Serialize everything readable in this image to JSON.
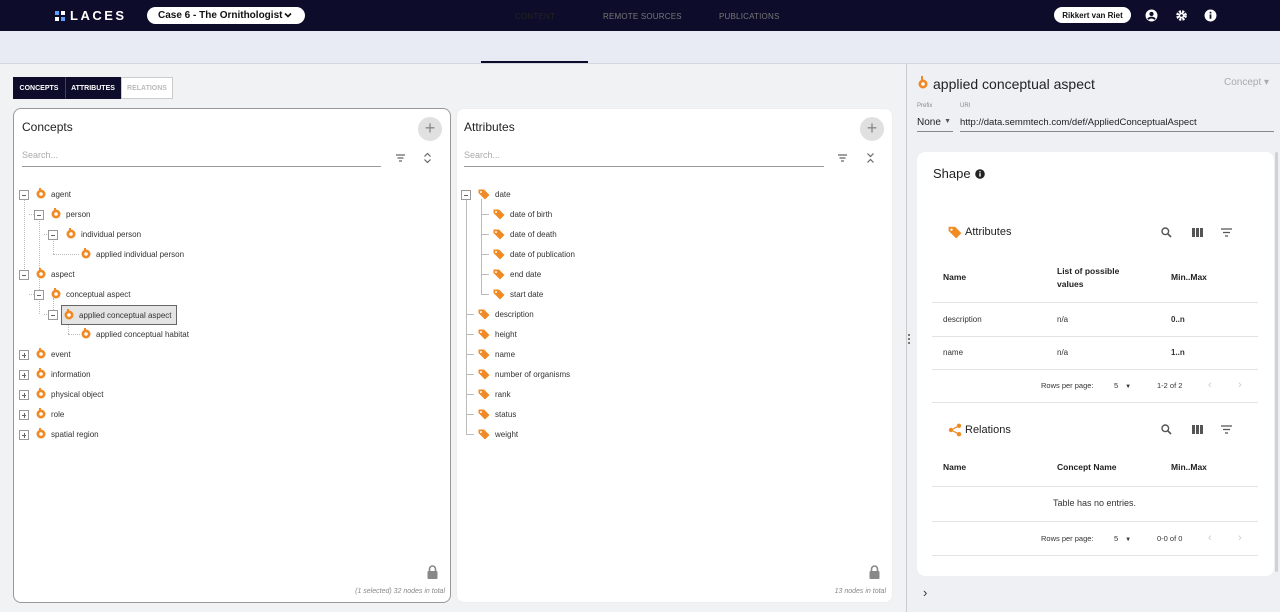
{
  "app": {
    "name": "LACES",
    "project": "Case 6 - The Ornithologist",
    "user": "Rikkert van Riet"
  },
  "tabs": [
    "CONTENT",
    "REMOTE SOURCES",
    "PUBLICATIONS"
  ],
  "segments": [
    "CONCEPTS",
    "ATTRIBUTES",
    "RELATIONS"
  ],
  "concepts": {
    "title": "Concepts",
    "search_placeholder": "Search...",
    "footer": "(1 selected) 32 nodes in total",
    "nodes": [
      {
        "label": "agent"
      },
      {
        "label": "person"
      },
      {
        "label": "individual person"
      },
      {
        "label": "applied individual person"
      },
      {
        "label": "aspect"
      },
      {
        "label": "conceptual aspect"
      },
      {
        "label": "applied conceptual aspect"
      },
      {
        "label": "applied conceptual habitat"
      },
      {
        "label": "event"
      },
      {
        "label": "information"
      },
      {
        "label": "physical object"
      },
      {
        "label": "role"
      },
      {
        "label": "spatial region"
      }
    ]
  },
  "attributes": {
    "title": "Attributes",
    "search_placeholder": "Search...",
    "footer": "13 nodes in total",
    "nodes": [
      {
        "label": "date"
      },
      {
        "label": "date of birth"
      },
      {
        "label": "date of death"
      },
      {
        "label": "date of publication"
      },
      {
        "label": "end date"
      },
      {
        "label": "start date"
      },
      {
        "label": "description"
      },
      {
        "label": "height"
      },
      {
        "label": "name"
      },
      {
        "label": "number of organisms"
      },
      {
        "label": "rank"
      },
      {
        "label": "status"
      },
      {
        "label": "weight"
      }
    ]
  },
  "detail": {
    "title": "applied conceptual aspect",
    "kind": "Concept",
    "prefix_label": "Prefix",
    "prefix_value": "None",
    "uri_label": "URI",
    "uri_value": "http://data.semmtech.com/def/AppliedConceptualAspect",
    "shape_title": "Shape",
    "attributes_section": {
      "title": "Attributes",
      "columns": [
        "Name",
        "List of possible values",
        "Min..Max"
      ],
      "rows": [
        [
          "description",
          "n/a",
          "0..n"
        ],
        [
          "name",
          "n/a",
          "1..n"
        ]
      ],
      "rows_per_page_label": "Rows per page:",
      "rows_per_page": "5",
      "range": "1-2 of 2"
    },
    "relations_section": {
      "title": "Relations",
      "columns": [
        "Name",
        "Concept Name",
        "Min..Max"
      ],
      "empty": "Table has no entries.",
      "rows_per_page_label": "Rows per page:",
      "rows_per_page": "5",
      "range": "0-0 of 0"
    }
  },
  "colors": {
    "navy": "#0d0d2b",
    "orange": "#f08a24"
  }
}
